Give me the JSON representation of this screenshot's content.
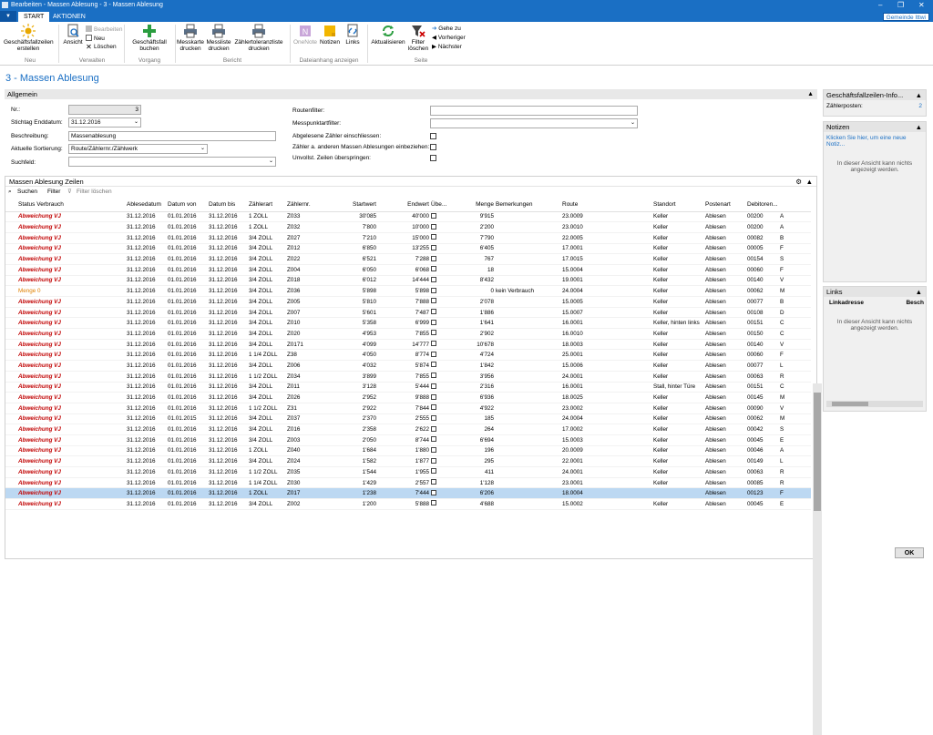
{
  "window": {
    "title": "Bearbeiten - Massen Ablesung - 3 - Massen Ablesung",
    "minimize": "–",
    "restore": "❐",
    "close": "✕"
  },
  "tabs": {
    "menu": "▼",
    "start": "START",
    "aktionen": "AKTIONEN"
  },
  "company": "Gemeinde Ittwi",
  "ribbon": {
    "geschaeftsfall_erstellen": "Geschäftsfallzeilen erstellen",
    "ansicht": "Ansicht",
    "bearbeiten": "Bearbeiten",
    "neu": "Neu",
    "loeschen": "Löschen",
    "geschaeftsfall_buchen": "Geschäftsfall buchen",
    "messkarte": "Messkarte drucken",
    "messliste": "Messliste drucken",
    "zaehlertoleranz": "Zählertoleranzliste drucken",
    "onenote": "OneNote",
    "notizen": "Notizen",
    "links": "Links",
    "aktualisieren": "Aktualisieren",
    "filter_loeschen": "Filter löschen",
    "gehe_zu": "Gehe zu",
    "vorheriger": "Vorheriger",
    "naechster": "Nächster",
    "groups": {
      "neu": "Neu",
      "verwalten": "Verwalten",
      "vorgang": "Vorgang",
      "bericht": "Bericht",
      "dateianhang": "Dateianhang anzeigen",
      "seite": "Seite"
    }
  },
  "page_title": "3 - Massen Ablesung",
  "allgemein": {
    "header": "Allgemein",
    "nr_label": "Nr.:",
    "nr_value": "3",
    "stichtag_label": "Stichtag Enddatum:",
    "stichtag_value": "31.12.2016",
    "beschreibung_label": "Beschreibung:",
    "beschreibung_value": "Massenablesung",
    "sortierung_label": "Aktuelle Sortierung:",
    "sortierung_value": "Route/Zählernr./Zählwerk",
    "suchfeld_label": "Suchfeld:",
    "suchfeld_value": "",
    "routenfilter_label": "Routenfilter:",
    "routenfilter_value": "",
    "messpunktartfilter_label": "Messpunktartfilter:",
    "messpunktartfilter_value": "",
    "abgelesene_label": "Abgelesene Zähler einschliessen:",
    "andere_label": "Zähler a. anderen Massen Ablesungen einbeziehen:",
    "unvollst_label": "Unvollst. Zeilen überspringen:"
  },
  "lines": {
    "header": "Massen Ablesung Zeilen",
    "suchen": "Suchen",
    "filter": "Filter",
    "filter_loeschen": "Filter löschen",
    "columns": [
      "Status Verbrauch",
      "Ablesedatum",
      "Datum von",
      "Datum bis",
      "Zählerart",
      "Zählernr.",
      "Startwert",
      "Endwert",
      "Übe...",
      "Menge",
      "Bemerkungen",
      "Route",
      "Standort",
      "Postenart",
      "Debitoren..."
    ],
    "rows": [
      [
        "Abweichung VJ",
        "31.12.2016",
        "01.01.2016",
        "31.12.2016",
        "1 ZOLL",
        "Z033",
        "30'085",
        "40'000",
        "",
        "9'915",
        "",
        "23.0009",
        "Keller",
        "Ablesen",
        "00200",
        "A"
      ],
      [
        "Abweichung VJ",
        "31.12.2016",
        "01.01.2016",
        "31.12.2016",
        "1 ZOLL",
        "Z032",
        "7'800",
        "10'000",
        "",
        "2'200",
        "",
        "23.0010",
        "Keller",
        "Ablesen",
        "00200",
        "A"
      ],
      [
        "Abweichung VJ",
        "31.12.2016",
        "01.01.2016",
        "31.12.2016",
        "3/4 ZOLL",
        "Z027",
        "7'210",
        "15'000",
        "",
        "7'790",
        "",
        "22.0005",
        "Keller",
        "Ablesen",
        "00082",
        "B"
      ],
      [
        "Abweichung VJ",
        "31.12.2016",
        "01.01.2016",
        "31.12.2016",
        "3/4 ZOLL",
        "Z012",
        "6'850",
        "13'255",
        "",
        "6'405",
        "",
        "17.0001",
        "Keller",
        "Ablesen",
        "00005",
        "F"
      ],
      [
        "Abweichung VJ",
        "31.12.2016",
        "01.01.2016",
        "31.12.2016",
        "3/4 ZOLL",
        "Z022",
        "6'521",
        "7'288",
        "",
        "767",
        "",
        "17.0015",
        "Keller",
        "Ablesen",
        "00154",
        "S"
      ],
      [
        "Abweichung VJ",
        "31.12.2016",
        "01.01.2016",
        "31.12.2016",
        "3/4 ZOLL",
        "Z004",
        "6'050",
        "6'068",
        "",
        "18",
        "",
        "15.0004",
        "Keller",
        "Ablesen",
        "00060",
        "F"
      ],
      [
        "Abweichung VJ",
        "31.12.2016",
        "01.01.2016",
        "31.12.2016",
        "3/4 ZOLL",
        "Z018",
        "6'012",
        "14'444",
        "",
        "8'432",
        "",
        "19.0001",
        "Keller",
        "Ablesen",
        "00140",
        "V"
      ],
      [
        "Menge 0",
        "31.12.2016",
        "01.01.2016",
        "31.12.2016",
        "3/4 ZOLL",
        "Z036",
        "5'898",
        "5'898",
        "",
        "0",
        "kein Verbrauch",
        "24.0004",
        "Keller",
        "Ablesen",
        "00062",
        "M"
      ],
      [
        "Abweichung VJ",
        "31.12.2016",
        "01.01.2016",
        "31.12.2016",
        "3/4 ZOLL",
        "Z005",
        "5'810",
        "7'888",
        "",
        "2'078",
        "",
        "15.0005",
        "Keller",
        "Ablesen",
        "00077",
        "B"
      ],
      [
        "Abweichung VJ",
        "31.12.2016",
        "01.01.2016",
        "31.12.2016",
        "3/4 ZOLL",
        "Z007",
        "5'601",
        "7'487",
        "",
        "1'886",
        "",
        "15.0007",
        "Keller",
        "Ablesen",
        "00108",
        "D"
      ],
      [
        "Abweichung VJ",
        "31.12.2016",
        "01.01.2016",
        "31.12.2016",
        "3/4 ZOLL",
        "Z010",
        "5'358",
        "6'999",
        "",
        "1'641",
        "",
        "16.0001",
        "Keller, hinten links",
        "Ablesen",
        "00151",
        "C"
      ],
      [
        "Abweichung VJ",
        "31.12.2016",
        "01.01.2016",
        "31.12.2016",
        "3/4 ZOLL",
        "Z020",
        "4'953",
        "7'855",
        "",
        "2'902",
        "",
        "16.0010",
        "Keller",
        "Ablesen",
        "00150",
        "C"
      ],
      [
        "Abweichung VJ",
        "31.12.2016",
        "01.01.2016",
        "31.12.2016",
        "3/4 ZOLL",
        "Z0171",
        "4'099",
        "14'777",
        "",
        "10'678",
        "",
        "18.0003",
        "Keller",
        "Ablesen",
        "00140",
        "V"
      ],
      [
        "Abweichung VJ",
        "31.12.2016",
        "01.01.2016",
        "31.12.2016",
        "1 1/4 ZOLL",
        "Z38",
        "4'050",
        "8'774",
        "",
        "4'724",
        "",
        "25.0001",
        "Keller",
        "Ablesen",
        "00060",
        "F"
      ],
      [
        "Abweichung VJ",
        "31.12.2016",
        "01.01.2016",
        "31.12.2016",
        "3/4 ZOLL",
        "Z006",
        "4'032",
        "5'874",
        "",
        "1'842",
        "",
        "15.0006",
        "Keller",
        "Ablesen",
        "00077",
        "L"
      ],
      [
        "Abweichung VJ",
        "31.12.2016",
        "01.01.2016",
        "31.12.2016",
        "1 1/2 ZOLL",
        "Z034",
        "3'899",
        "7'855",
        "",
        "3'956",
        "",
        "24.0001",
        "Keller",
        "Ablesen",
        "00063",
        "R"
      ],
      [
        "Abweichung VJ",
        "31.12.2016",
        "01.01.2016",
        "31.12.2016",
        "3/4 ZOLL",
        "Z011",
        "3'128",
        "5'444",
        "",
        "2'316",
        "",
        "16.0001",
        "Stall, hinter Türe",
        "Ablesen",
        "00151",
        "C"
      ],
      [
        "Abweichung VJ",
        "31.12.2016",
        "01.01.2016",
        "31.12.2016",
        "3/4 ZOLL",
        "Z026",
        "2'952",
        "9'888",
        "",
        "6'936",
        "",
        "18.0025",
        "Keller",
        "Ablesen",
        "00145",
        "M"
      ],
      [
        "Abweichung VJ",
        "31.12.2016",
        "01.01.2016",
        "31.12.2016",
        "1 1/2 ZOLL",
        "Z31",
        "2'922",
        "7'844",
        "",
        "4'922",
        "",
        "23.0002",
        "Keller",
        "Ablesen",
        "00090",
        "V"
      ],
      [
        "Abweichung VJ",
        "31.12.2016",
        "01.01.2015",
        "31.12.2016",
        "3/4 ZOLL",
        "Z037",
        "2'370",
        "2'555",
        "",
        "185",
        "",
        "24.0004",
        "Keller",
        "Ablesen",
        "00062",
        "M"
      ],
      [
        "Abweichung VJ",
        "31.12.2016",
        "01.01.2016",
        "31.12.2016",
        "3/4 ZOLL",
        "Z016",
        "2'358",
        "2'622",
        "",
        "264",
        "",
        "17.0002",
        "Keller",
        "Ablesen",
        "00042",
        "S"
      ],
      [
        "Abweichung VJ",
        "31.12.2016",
        "01.01.2016",
        "31.12.2016",
        "3/4 ZOLL",
        "Z003",
        "2'050",
        "8'744",
        "",
        "6'694",
        "",
        "15.0003",
        "Keller",
        "Ablesen",
        "00045",
        "E"
      ],
      [
        "Abweichung VJ",
        "31.12.2016",
        "01.01.2016",
        "31.12.2016",
        "1 ZOLL",
        "Z040",
        "1'684",
        "1'880",
        "",
        "196",
        "",
        "20.0009",
        "Keller",
        "Ablesen",
        "00046",
        "A"
      ],
      [
        "Abweichung VJ",
        "31.12.2016",
        "01.01.2016",
        "31.12.2016",
        "3/4 ZOLL",
        "Z024",
        "1'582",
        "1'877",
        "",
        "295",
        "",
        "22.0001",
        "Keller",
        "Ablesen",
        "00149",
        "L"
      ],
      [
        "Abweichung VJ",
        "31.12.2016",
        "01.01.2016",
        "31.12.2016",
        "1 1/2 ZOLL",
        "Z035",
        "1'544",
        "1'955",
        "",
        "411",
        "",
        "24.0001",
        "Keller",
        "Ablesen",
        "00063",
        "R"
      ],
      [
        "Abweichung VJ",
        "31.12.2016",
        "01.01.2016",
        "31.12.2016",
        "1 1/4 ZOLL",
        "Z030",
        "1'429",
        "2'557",
        "",
        "1'128",
        "",
        "23.0001",
        "Keller",
        "Ablesen",
        "00085",
        "R"
      ],
      [
        "Abweichung VJ",
        "31.12.2016",
        "01.01.2016",
        "31.12.2016",
        "1 ZOLL",
        "Z017",
        "1'238",
        "7'444",
        "",
        "6'206",
        "",
        "18.0004",
        "",
        "Ablesen",
        "00123",
        "F"
      ],
      [
        "Abweichung VJ",
        "31.12.2016",
        "01.01.2016",
        "31.12.2016",
        "3/4 ZOLL",
        "Z002",
        "1'200",
        "5'888",
        "",
        "4'688",
        "",
        "15.0002",
        "Keller",
        "Ablesen",
        "00045",
        "E"
      ]
    ]
  },
  "factbox": {
    "gf_header": "Geschäftsfallzeilen-Info...",
    "zaehlerposten_label": "Zählerposten:",
    "zaehlerposten_value": "2",
    "notizen_header": "Notizen",
    "notizen_link": "Klicken Sie hier, um eine neue Notiz...",
    "notizen_msg": "In dieser Ansicht kann nichts angezeigt werden.",
    "links_header": "Links",
    "linkadresse": "Linkadresse",
    "besch": "Besch",
    "links_msg": "In dieser Ansicht kann nichts angezeigt werden."
  },
  "ok": "OK",
  "colors": {
    "accent": "#1a6fc4",
    "selected_row": "#bcd8f2",
    "status_red": "#c00000",
    "status_orange": "#e08000"
  }
}
